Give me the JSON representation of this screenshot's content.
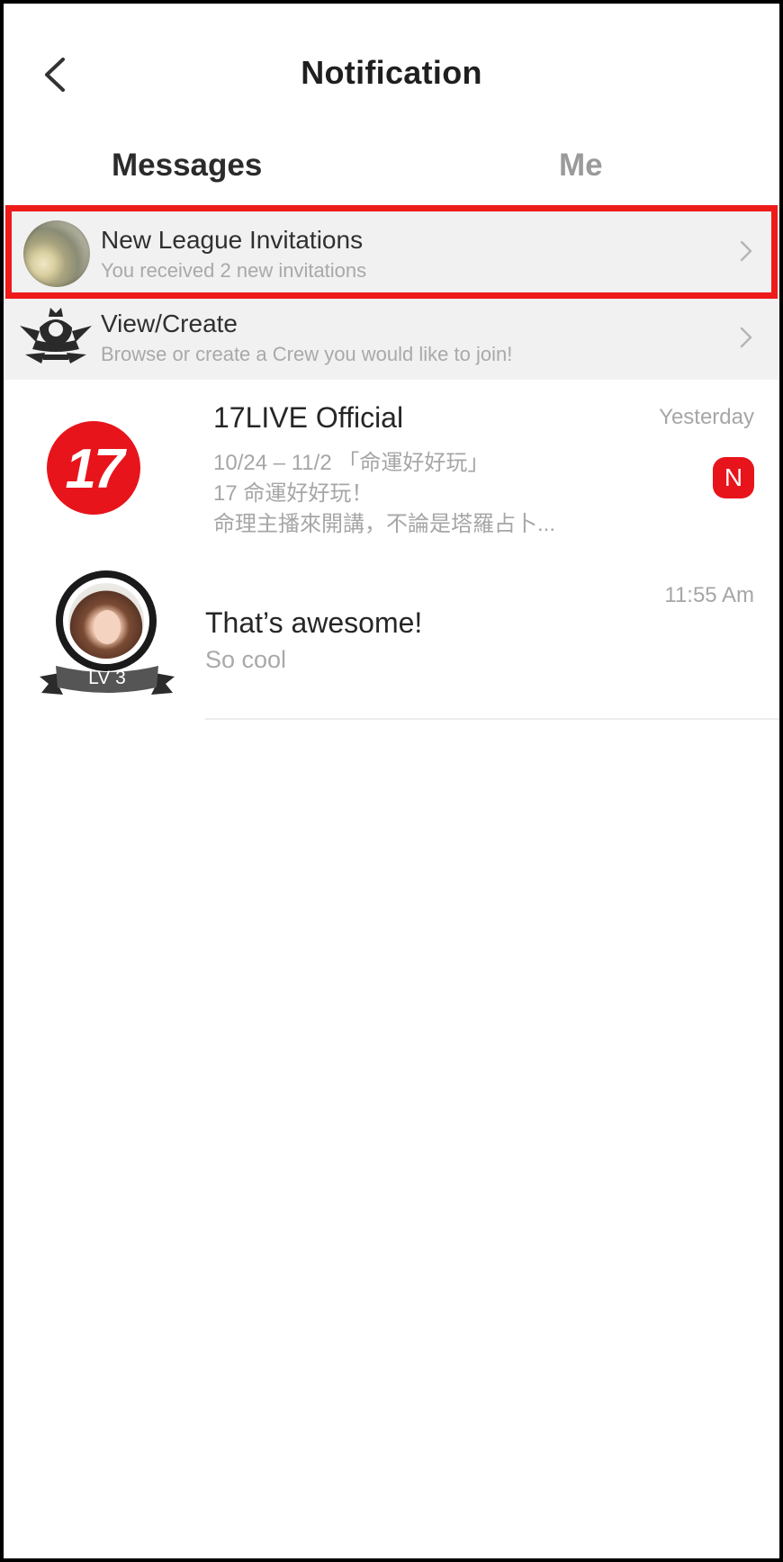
{
  "header": {
    "title": "Notification"
  },
  "tabs": [
    {
      "label": "Messages",
      "active": true
    },
    {
      "label": "Me",
      "active": false
    }
  ],
  "rows": {
    "league": {
      "title": "New League Invitations",
      "subtitle": "You received 2 new invitations"
    },
    "crew": {
      "title": "View/Create",
      "subtitle": "Browse or create a Crew you would like to join!"
    }
  },
  "messages": [
    {
      "sender": "17LIVE Official",
      "logo_text": "17",
      "time": "Yesterday",
      "badge": "N",
      "lines": [
        "10/24 – 11/2 「命運好好玩」",
        "17 命運好好玩！",
        "命理主播來開講，不論是塔羅占卜..."
      ]
    },
    {
      "title": "That’s awesome!",
      "preview": "So cool",
      "time": "11:55 Am",
      "level": "LV 3"
    }
  ],
  "colors": {
    "brand_red": "#e8141b",
    "highlight_red": "#ee1b1b",
    "row_gray": "#f1f1f1",
    "muted_text": "#a6a6a6"
  },
  "icons": [
    "back-arrow-icon",
    "chevron-right-icon",
    "crew-emblem-icon",
    "17live-logo-icon",
    "new-badge-icon"
  ]
}
